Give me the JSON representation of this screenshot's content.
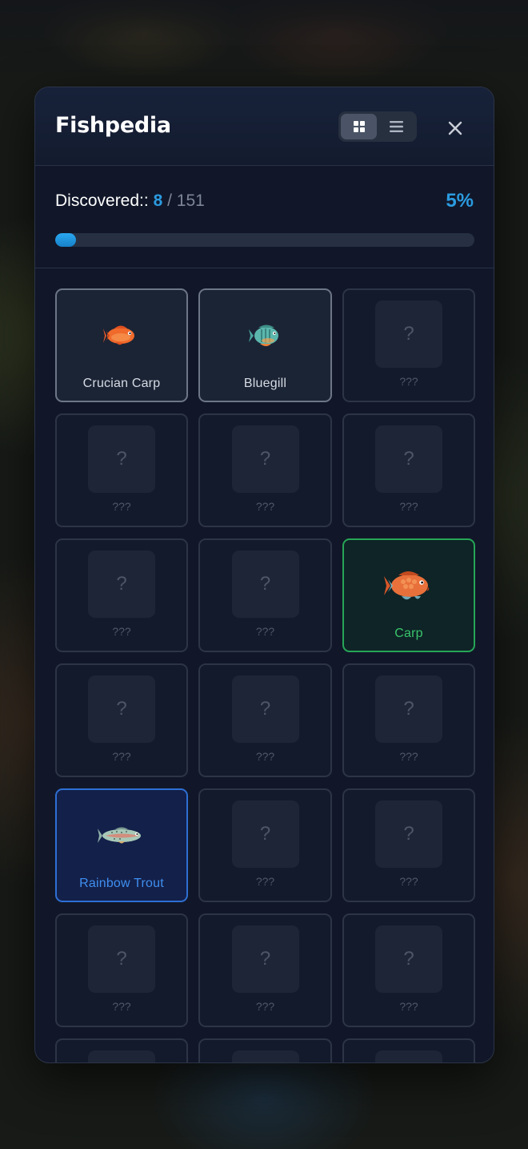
{
  "modal": {
    "title": "Fishpedia",
    "view_modes": [
      "grid-view-icon",
      "list-view-icon"
    ],
    "active_view": "grid",
    "close_icon": "close-icon"
  },
  "progress": {
    "label": "Discovered::",
    "discovered": "8",
    "separator": "/",
    "total": "151",
    "percent_label": "5%",
    "fraction": 0.05,
    "accent_color": "#2b9be0"
  },
  "colors": {
    "known_border": "#6d7686",
    "green_border": "#27a556",
    "blue_border": "#2e6fd4"
  },
  "grid": {
    "cards": [
      {
        "name": "Crucian Carp",
        "state": "known",
        "icon": "crucian-carp-icon"
      },
      {
        "name": "Bluegill",
        "state": "known",
        "icon": "bluegill-icon"
      },
      {
        "name": "???",
        "state": "unknown",
        "mark": "?"
      },
      {
        "name": "???",
        "state": "unknown",
        "mark": "?"
      },
      {
        "name": "???",
        "state": "unknown",
        "mark": "?"
      },
      {
        "name": "???",
        "state": "unknown",
        "mark": "?"
      },
      {
        "name": "???",
        "state": "unknown",
        "mark": "?"
      },
      {
        "name": "???",
        "state": "unknown",
        "mark": "?"
      },
      {
        "name": "Carp",
        "state": "green",
        "icon": "carp-icon"
      },
      {
        "name": "???",
        "state": "unknown",
        "mark": "?"
      },
      {
        "name": "???",
        "state": "unknown",
        "mark": "?"
      },
      {
        "name": "???",
        "state": "unknown",
        "mark": "?"
      },
      {
        "name": "Rainbow Trout",
        "state": "blue",
        "icon": "rainbow-trout-icon"
      },
      {
        "name": "???",
        "state": "unknown",
        "mark": "?"
      },
      {
        "name": "???",
        "state": "unknown",
        "mark": "?"
      },
      {
        "name": "???",
        "state": "unknown",
        "mark": "?"
      },
      {
        "name": "???",
        "state": "unknown",
        "mark": "?"
      },
      {
        "name": "???",
        "state": "unknown",
        "mark": "?"
      }
    ]
  }
}
